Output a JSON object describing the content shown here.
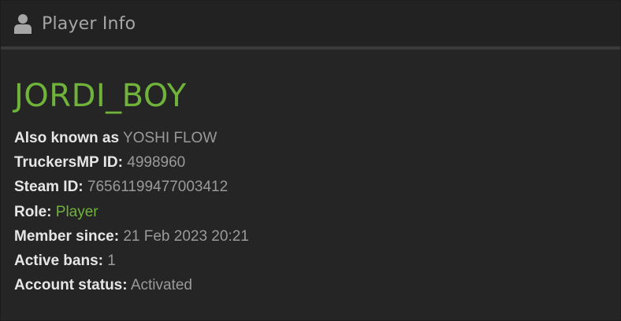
{
  "header": {
    "icon": "user-icon",
    "title": "Player Info"
  },
  "player": {
    "name": "JORDI_BOY"
  },
  "colors": {
    "accent": "#6fb33b",
    "label": "#e6e6e6",
    "value": "#9a9a9a",
    "background": "#252525"
  },
  "rows": [
    {
      "label": "Also known as",
      "value": "YOSHI FLOW"
    },
    {
      "label": "TruckersMP ID:",
      "value": "4998960"
    },
    {
      "label": "Steam ID:",
      "value": "76561199477003412"
    },
    {
      "label": "Role:",
      "value": "Player"
    },
    {
      "label": "Member since:",
      "value": "21 Feb 2023 20:21"
    },
    {
      "label": "Active bans:",
      "value": "1"
    },
    {
      "label": "Account status:",
      "value": "Activated"
    }
  ]
}
